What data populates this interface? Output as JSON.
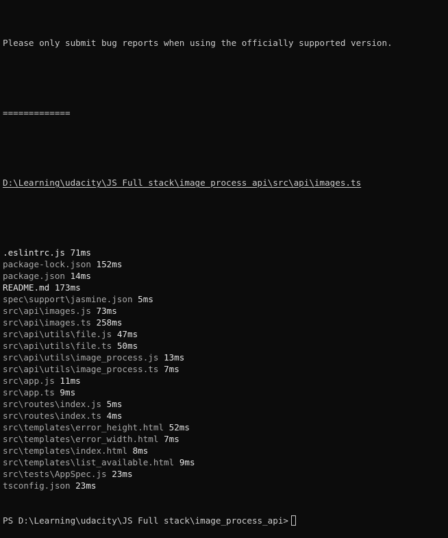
{
  "terminal": {
    "notice": "Please only submit bug reports when using the officially supported version.",
    "separator": "=============",
    "current_file": "D:\\Learning\\udacity\\JS Full stack\\image_process_api\\src\\api\\images.ts",
    "files": [
      {
        "name": ".eslintrc.js",
        "time": "71ms",
        "changed": true
      },
      {
        "name": "package-lock.json",
        "time": "152ms",
        "changed": false
      },
      {
        "name": "package.json",
        "time": "14ms",
        "changed": false
      },
      {
        "name": "README.md",
        "time": "173ms",
        "changed": true
      },
      {
        "name": "spec\\support\\jasmine.json",
        "time": "5ms",
        "changed": false
      },
      {
        "name": "src\\api\\images.js",
        "time": "73ms",
        "changed": false
      },
      {
        "name": "src\\api\\images.ts",
        "time": "258ms",
        "changed": false
      },
      {
        "name": "src\\api\\utils\\file.js",
        "time": "47ms",
        "changed": false
      },
      {
        "name": "src\\api\\utils\\file.ts",
        "time": "50ms",
        "changed": false
      },
      {
        "name": "src\\api\\utils\\image_process.js",
        "time": "13ms",
        "changed": false
      },
      {
        "name": "src\\api\\utils\\image_process.ts",
        "time": "7ms",
        "changed": false
      },
      {
        "name": "src\\app.js",
        "time": "11ms",
        "changed": false
      },
      {
        "name": "src\\app.ts",
        "time": "9ms",
        "changed": false
      },
      {
        "name": "src\\routes\\index.js",
        "time": "5ms",
        "changed": false
      },
      {
        "name": "src\\routes\\index.ts",
        "time": "4ms",
        "changed": false
      },
      {
        "name": "src\\templates\\error_height.html",
        "time": "52ms",
        "changed": false
      },
      {
        "name": "src\\templates\\error_width.html",
        "time": "7ms",
        "changed": false
      },
      {
        "name": "src\\templates\\index.html",
        "time": "8ms",
        "changed": false
      },
      {
        "name": "src\\templates\\list_available.html",
        "time": "9ms",
        "changed": false
      },
      {
        "name": "src\\tests\\AppSpec.js",
        "time": "23ms",
        "changed": false
      },
      {
        "name": "tsconfig.json",
        "time": "23ms",
        "changed": false
      }
    ],
    "prompt": "PS D:\\Learning\\udacity\\JS Full stack\\image_process_api>"
  }
}
